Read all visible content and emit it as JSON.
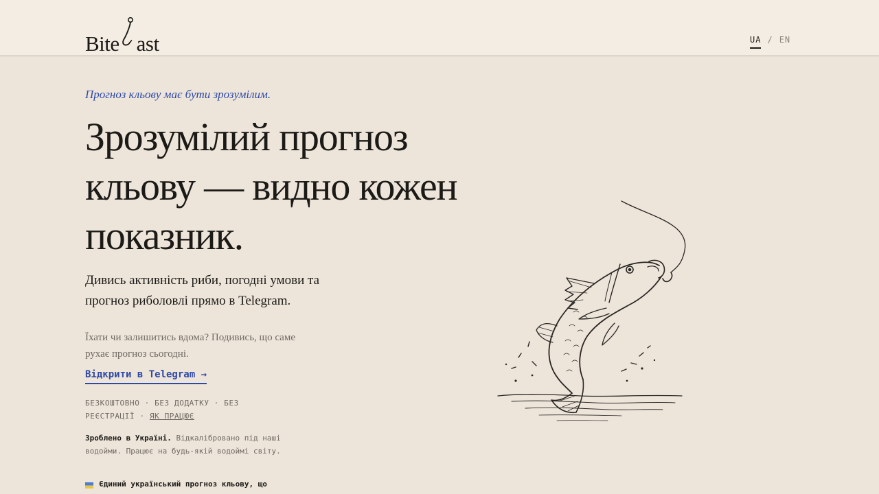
{
  "header": {
    "logo_left": "Bite",
    "logo_right": "ast",
    "lang_active": "UA",
    "lang_separator": "/",
    "lang_other": "EN"
  },
  "hero": {
    "tagline": "Прогноз кльову має бути зрозумілим.",
    "headline": "Зрозумілий прогноз кльову — видно кожен показник.",
    "lead": "Дивись активність риби, погодні умови та прогноз риболовлі прямо в Telegram.",
    "sub": "Їхати чи залишитись вдома? Подивись, що саме рухає прогноз сьогодні.",
    "cta_label": "Відкрити в Telegram →",
    "meta_text": "БЕЗКОШТОВНО · БЕЗ ДОДАТКУ · БЕЗ РЕЄСТРАЦІЇ · ",
    "meta_link": "ЯК ПРАЦЮЄ",
    "made_bold": "Зроблено в Україні.",
    "made_text": " Відкалібровано під наші водойми. Працює на будь-якій водоймі світу.",
    "unique_text": "Єдиний український прогноз кльову, що"
  },
  "icons": {
    "hook": "fishing-hook-icon",
    "flag": "ukraine-flag-icon",
    "illustration": "jumping-fish-illustration"
  },
  "colors": {
    "accent": "#2e49a6",
    "background": "#ede5da",
    "header_bg": "#f4ede3",
    "text": "#1c1a17",
    "muted": "#6f6a63"
  }
}
